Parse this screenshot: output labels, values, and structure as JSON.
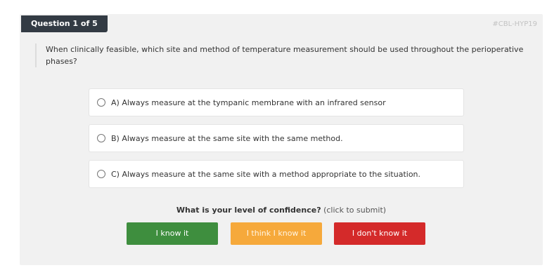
{
  "header": {
    "question_counter": "Question 1 of 5",
    "question_code": "#CBL-HYP19"
  },
  "question": {
    "text": "When clinically feasible, which site and method of temperature measurement should be used throughout the perioperative phases?"
  },
  "options": [
    {
      "label": "A) Always measure at the tympanic membrane with an infrared sensor"
    },
    {
      "label": "B) Always measure at the same site with the same method."
    },
    {
      "label": "C) Always measure at the same site with a method appropriate to the situation."
    }
  ],
  "confidence": {
    "prompt": "What is your level of confidence?",
    "hint": "(click to submit)",
    "buttons": {
      "know": "I know it",
      "think": "I think I know it",
      "dont": "I don't know it"
    }
  },
  "colors": {
    "badge": "#333b44",
    "know": "#3e8e3e",
    "think": "#f6a93b",
    "dont": "#d42a2a"
  }
}
